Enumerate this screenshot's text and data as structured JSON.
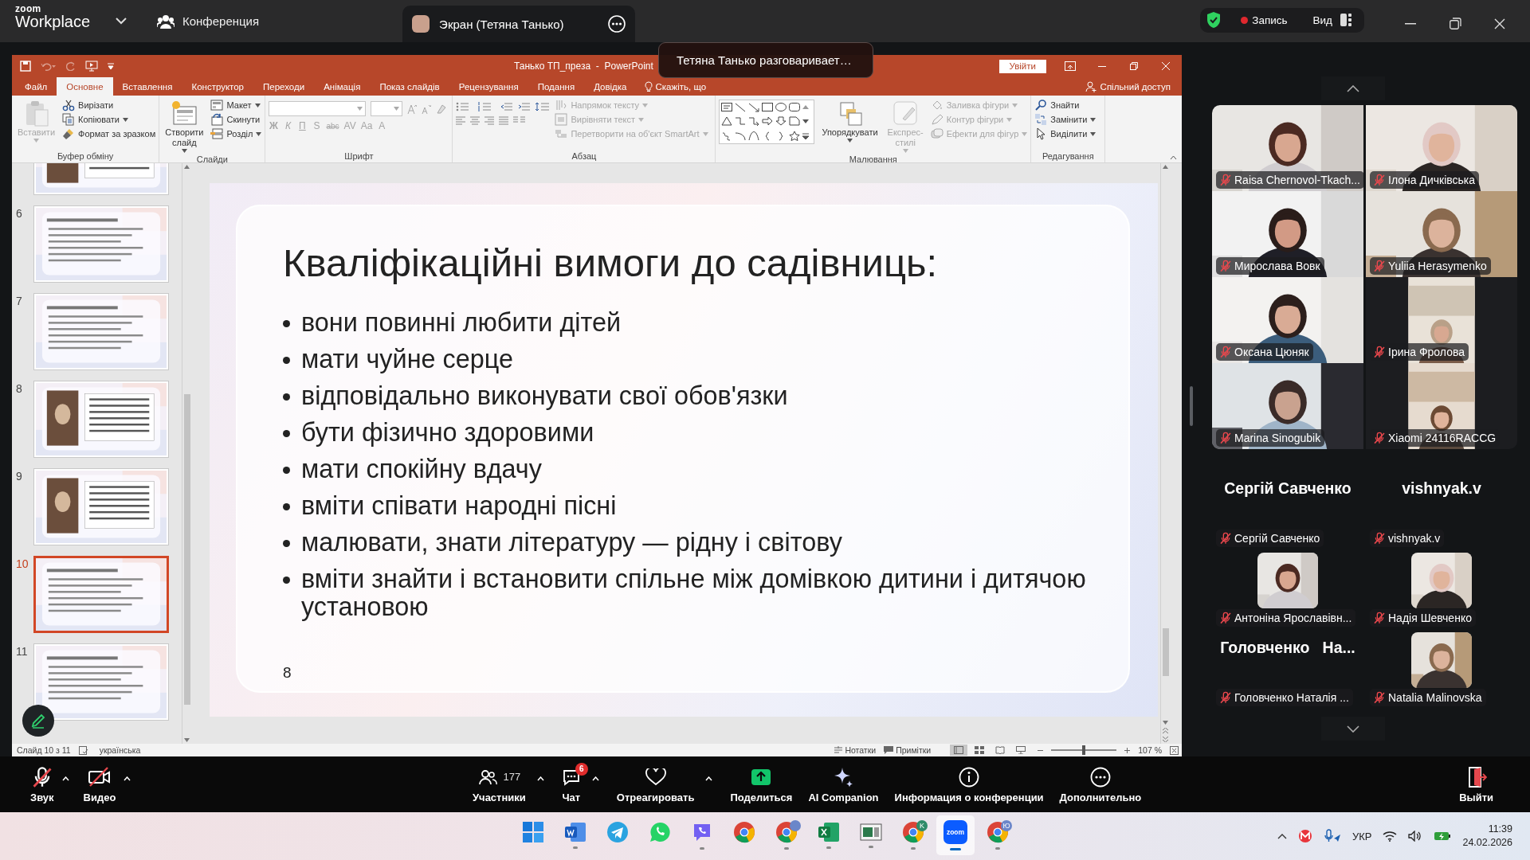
{
  "zoom_window": {
    "logo_small": "zoom",
    "logo": "Workplace",
    "meeting_tab": "Конференция",
    "share_tab": "Экран (Тетяна Танько)",
    "recording": "Запись",
    "view": "Вид"
  },
  "toast": "Тетяна Танько разговаривает…",
  "powerpoint": {
    "title": "Танько ТП_преза  -  PowerPoint",
    "sign_in": "Увійти",
    "tabs": [
      {
        "label": "Файл",
        "selected": false
      },
      {
        "label": "Основне",
        "selected": true
      },
      {
        "label": "Вставлення",
        "selected": false
      },
      {
        "label": "Конструктор",
        "selected": false
      },
      {
        "label": "Переходи",
        "selected": false
      },
      {
        "label": "Анімація",
        "selected": false
      },
      {
        "label": "Показ слайдів",
        "selected": false
      },
      {
        "label": "Рецензування",
        "selected": false
      },
      {
        "label": "Подання",
        "selected": false
      },
      {
        "label": "Довідка",
        "selected": false
      }
    ],
    "tell_me": "Скажіть, що",
    "share": "Спільний доступ",
    "ribbon_groups": [
      {
        "label": "Буфер обміну",
        "items": [
          {
            "kind": "large",
            "label": "Вставити",
            "disabled": true,
            "dropdown": true
          },
          {
            "kind": "small",
            "label": "Вирізати",
            "disabled": false
          },
          {
            "kind": "small",
            "label": "Копіювати",
            "disabled": false,
            "dropdown": true
          },
          {
            "kind": "small",
            "label": "Формат за зразком",
            "disabled": false
          }
        ]
      },
      {
        "label": "Слайди",
        "items": [
          {
            "kind": "large",
            "label": "Створити слайд",
            "disabled": false,
            "dropdown": true
          },
          {
            "kind": "small",
            "label": "Макет",
            "disabled": false,
            "dropdown": true
          },
          {
            "kind": "small",
            "label": "Скинути",
            "disabled": false
          },
          {
            "kind": "small",
            "label": "Розділ",
            "disabled": false,
            "dropdown": true
          }
        ]
      },
      {
        "label": "Шрифт",
        "items": [
          {
            "kind": "font_controls",
            "disabled": true,
            "buttons": [
              "Ж",
              "К",
              "П",
              "S",
              "abc",
              "AV",
              "Aa",
              "A"
            ]
          }
        ]
      },
      {
        "label": "Абзац",
        "items": [
          {
            "kind": "paragraph_controls"
          },
          {
            "kind": "small",
            "label": "Напрямок тексту",
            "disabled": true,
            "dropdown": true
          },
          {
            "kind": "small",
            "label": "Вирівняти текст",
            "disabled": true,
            "dropdown": true
          },
          {
            "kind": "small",
            "label": "Перетворити на об'єкт SmartArt",
            "disabled": true,
            "dropdown": true
          }
        ]
      },
      {
        "label": "Малювання",
        "items": [
          {
            "kind": "shape_gallery"
          },
          {
            "kind": "large",
            "label": "Упорядкувати",
            "disabled": false,
            "dropdown": true
          },
          {
            "kind": "large",
            "label": "Експрес-стилі",
            "disabled": true,
            "dropdown": true
          },
          {
            "kind": "small",
            "label": "Заливка фігури",
            "disabled": true,
            "dropdown": true
          },
          {
            "kind": "small",
            "label": "Контур фігури",
            "disabled": true,
            "dropdown": true
          },
          {
            "kind": "small",
            "label": "Ефекти для фігур",
            "disabled": true,
            "dropdown": true
          }
        ]
      },
      {
        "label": "Редагування",
        "items": [
          {
            "kind": "small",
            "label": "Знайти",
            "disabled": false
          },
          {
            "kind": "small",
            "label": "Замінити",
            "disabled": false,
            "dropdown": true
          },
          {
            "kind": "small",
            "label": "Виділити",
            "disabled": false,
            "dropdown": true
          }
        ]
      }
    ],
    "slides": [
      {
        "selected": false
      },
      {
        "number": "6",
        "selected": false
      },
      {
        "number": "7",
        "selected": false
      },
      {
        "number": "8",
        "selected": false
      },
      {
        "number": "9",
        "selected": false
      },
      {
        "number": "10",
        "selected": true
      },
      {
        "number": "11",
        "selected": false
      }
    ],
    "slide": {
      "title": "Кваліфікаційні вимоги до садівниць:",
      "bullets": [
        "вони повинні любити дітей",
        "мати чуйне серце",
        "відповідально виконувати свої обов'язки",
        "бути фізично здоровими",
        "мати спокійну вдачу",
        "вміти співати народні пісні",
        "малювати, знати літературу — рідну і світову",
        "вміти знайти і встановити спільне між домівкою дитини і дитячою установою"
      ],
      "page_number": "8"
    },
    "status": {
      "slide_info": "Слайд 10 з 11",
      "language": "українська",
      "notes": "Нотатки",
      "comments": "Примітки",
      "view_buttons": [
        {
          "selected": true
        },
        {
          "selected": false
        },
        {
          "selected": false
        },
        {
          "selected": false
        }
      ],
      "zoom_slider": {
        "level": 0.5
      },
      "zoom": "107 %"
    }
  },
  "gallery": [
    {
      "kind": "video",
      "name": "Raisa Chernovol-Tkach...",
      "muted": true
    },
    {
      "kind": "video",
      "name": "Ілона Дичківська",
      "muted": true
    },
    {
      "kind": "video",
      "name": "Мирослава Вовк",
      "muted": true
    },
    {
      "kind": "video",
      "name": "Yuliia Herasymenko",
      "muted": true
    },
    {
      "kind": "video",
      "name": "Оксана Цюняк",
      "muted": true
    },
    {
      "kind": "portrait_video",
      "name": "Ірина Фролова",
      "muted": true
    },
    {
      "kind": "video",
      "name": "Marina Sinogubik",
      "muted": true
    },
    {
      "kind": "portrait_video",
      "name": "Xiaomi 24116RACCG",
      "muted": true
    },
    {
      "kind": "name",
      "display_name": "Сергій Савченко",
      "name": "Сергій Савченко",
      "muted": true
    },
    {
      "kind": "name",
      "display_name": "vishnyak.v",
      "name": "vishnyak.v",
      "muted": true
    },
    {
      "name": "Антоніна Ярославівн...",
      "muted": true
    },
    {
      "name": "Надія Шевченко",
      "muted": true
    },
    {
      "kind": "name",
      "display_name": "Головченко   На...",
      "name": "Головченко  Наталія ...",
      "muted": true
    },
    {
      "name": "Natalia Malinovska",
      "muted": true
    }
  ],
  "toolbar": [
    {
      "kind": "audio",
      "label": "Звук",
      "muted": true,
      "menu": true
    },
    {
      "kind": "video",
      "label": "Видео",
      "muted": true,
      "menu": true
    },
    {
      "kind": "participants",
      "label": "Участники",
      "count": "177",
      "menu": true
    },
    {
      "kind": "chat",
      "label": "Чат",
      "badge": "6",
      "menu": true
    },
    {
      "kind": "react",
      "label": "Отреагировать",
      "menu": true
    },
    {
      "kind": "share",
      "label": "Поделиться"
    },
    {
      "kind": "ai",
      "label": "AI Companion"
    },
    {
      "kind": "info",
      "label": "Информация о конференции"
    },
    {
      "kind": "more",
      "label": "Дополнительно"
    }
  ],
  "leave": "Выйти",
  "taskbar": {
    "apps": [
      {
        "kind": "start",
        "running": false,
        "selected": false
      },
      {
        "kind": "word",
        "running": true,
        "selected": false
      },
      {
        "kind": "telegram",
        "running": false,
        "selected": false
      },
      {
        "kind": "whatsapp",
        "running": false,
        "selected": false
      },
      {
        "kind": "viber",
        "running": true,
        "selected": false
      },
      {
        "kind": "chrome",
        "running": false,
        "selected": false
      },
      {
        "kind": "chrome_photo",
        "running": true,
        "selected": false
      },
      {
        "kind": "excel",
        "running": true,
        "selected": false
      },
      {
        "kind": "window",
        "running": true,
        "selected": false
      },
      {
        "kind": "chrome_badge",
        "badge": "K",
        "running": true,
        "selected": false
      },
      {
        "kind": "zoom",
        "label": "zoom",
        "running": true,
        "selected": true
      },
      {
        "kind": "chrome_badge",
        "badge": "Ю",
        "running": true,
        "selected": false
      }
    ],
    "language": "УКР",
    "time": "11:39",
    "date": "24.02.2026"
  }
}
